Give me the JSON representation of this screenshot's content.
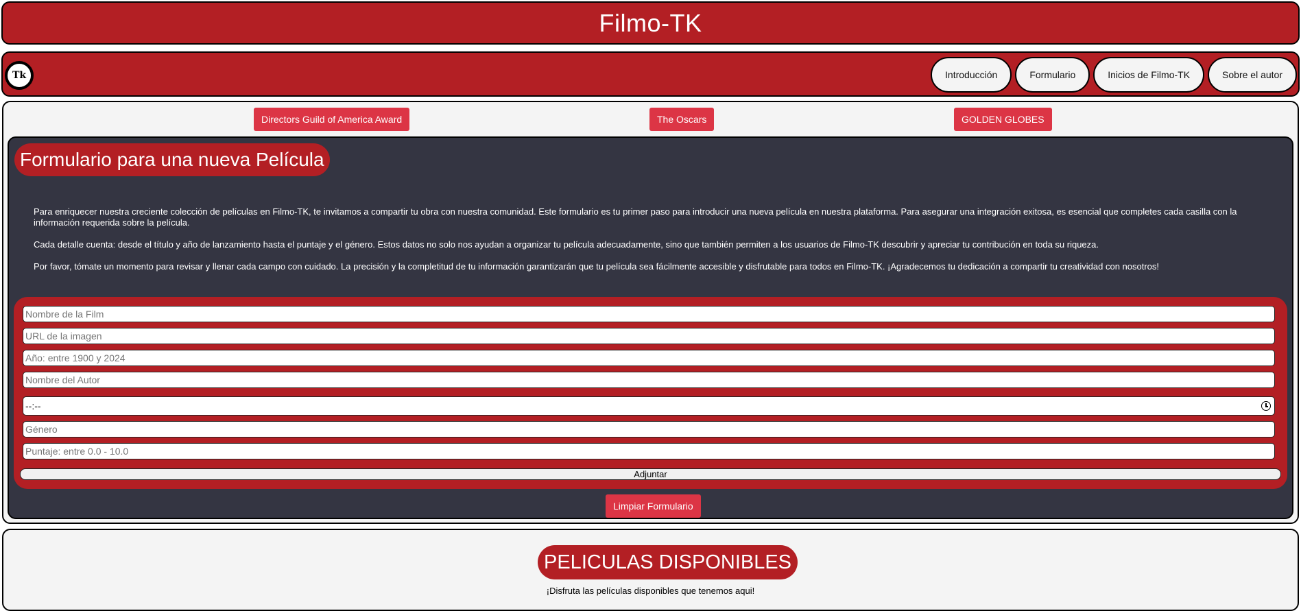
{
  "header": {
    "title": "Filmo-TK"
  },
  "navbar": {
    "logo_text": "Tk",
    "links": [
      "Introducción",
      "Formulario",
      "Inicios de Filmo-TK",
      "Sobre el autor"
    ]
  },
  "awards": [
    "Directors Guild of America Award",
    "The Oscars",
    "GOLDEN GLOBES"
  ],
  "form_section": {
    "title": "Formulario para una nueva Película",
    "paragraphs": [
      "Para enriquecer nuestra creciente colección de películas en Filmo-TK, te invitamos a compartir tu obra con nuestra comunidad. Este formulario es tu primer paso para introducir una nueva película en nuestra plataforma. Para asegurar una integración exitosa, es esencial que completes cada casilla con la información requerida sobre la película.",
      "Cada detalle cuenta: desde el título y año de lanzamiento hasta el puntaje y el género. Estos datos no solo nos ayudan a organizar tu película adecuadamente, sino que también permiten a los usuarios de Filmo-TK descubrir y apreciar tu contribución en toda su riqueza.",
      "Por favor, tómate un momento para revisar y llenar cada campo con cuidado. La precisión y la completitud de tu información garantizarán que tu película sea fácilmente accesible y disfrutable para todos en Filmo-TK. ¡Agradecemos tu dedicación a compartir tu creatividad con nosotros!"
    ],
    "fields": {
      "name_placeholder": "Nombre de la Film",
      "image_placeholder": "URL de la imagen",
      "year_placeholder": "Año: entre 1900 y 2024",
      "author_placeholder": "Nombre del Autor",
      "duration_value": "--:--",
      "genre_placeholder": "Género",
      "score_placeholder": "Puntaje: entre 0.0 - 10.0"
    },
    "submit_label": "Adjuntar",
    "clear_label": "Limpiar Formulario"
  },
  "movies_section": {
    "title": "PELICULAS DISPONIBLES",
    "subtitle": "¡Disfruta las películas disponibles que tenemos aqui!"
  }
}
